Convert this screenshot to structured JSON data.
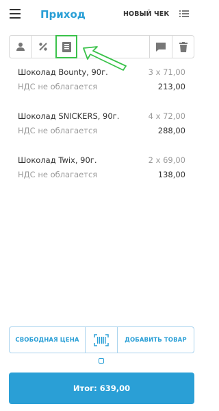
{
  "header": {
    "title": "Приход",
    "new_check_label": "НОВЫЙ ЧЕК",
    "menu_icon": "hamburger-menu-icon",
    "list_icon": "list-icon"
  },
  "toolbar": {
    "icons": [
      "user-icon",
      "percent-icon",
      "document-icon",
      "chat-icon",
      "trash-icon"
    ],
    "highlight_color": "#3ac24a"
  },
  "items": [
    {
      "name": "Шоколад Bounty, 90г.",
      "qty": "3 х 71,00",
      "vat": "НДС не облагается",
      "sum": "213,00"
    },
    {
      "name": "Шоколад SNICKERS, 90г.",
      "qty": "4 х 72,00",
      "vat": "НДС не облагается",
      "sum": "288,00"
    },
    {
      "name": "Шоколад Twix, 90г.",
      "qty": "2 х 69,00",
      "vat": "НДС не облагается",
      "sum": "138,00"
    }
  ],
  "bottom": {
    "free_price_label": "СВОБОДНАЯ ЦЕНА",
    "add_item_label": "ДОБАВИТЬ ТОВАР",
    "scan_icon": "barcode-scanner-icon"
  },
  "total": {
    "label": "Итог: 639,00"
  },
  "colors": {
    "accent": "#2a9fd6",
    "muted_text": "#9a9a9a",
    "border": "#d8d8d8"
  }
}
